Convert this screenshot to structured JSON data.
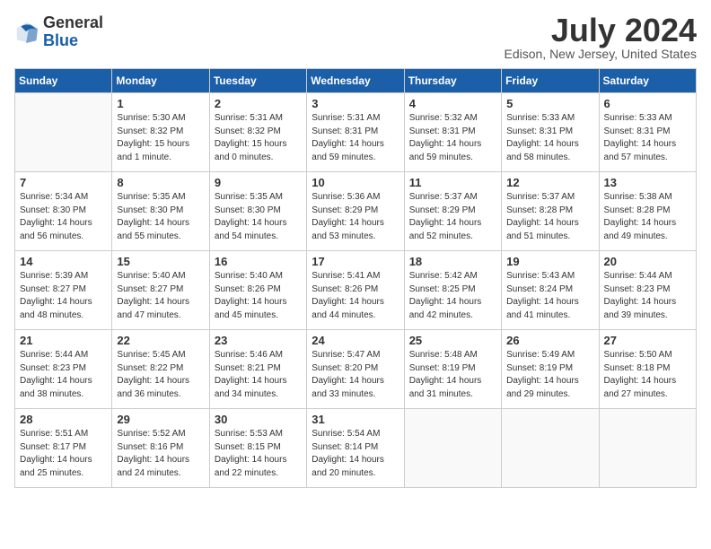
{
  "header": {
    "logo_general": "General",
    "logo_blue": "Blue",
    "month_title": "July 2024",
    "location": "Edison, New Jersey, United States"
  },
  "weekdays": [
    "Sunday",
    "Monday",
    "Tuesday",
    "Wednesday",
    "Thursday",
    "Friday",
    "Saturday"
  ],
  "weeks": [
    [
      {
        "day": "",
        "info": ""
      },
      {
        "day": "1",
        "info": "Sunrise: 5:30 AM\nSunset: 8:32 PM\nDaylight: 15 hours\nand 1 minute."
      },
      {
        "day": "2",
        "info": "Sunrise: 5:31 AM\nSunset: 8:32 PM\nDaylight: 15 hours\nand 0 minutes."
      },
      {
        "day": "3",
        "info": "Sunrise: 5:31 AM\nSunset: 8:31 PM\nDaylight: 14 hours\nand 59 minutes."
      },
      {
        "day": "4",
        "info": "Sunrise: 5:32 AM\nSunset: 8:31 PM\nDaylight: 14 hours\nand 59 minutes."
      },
      {
        "day": "5",
        "info": "Sunrise: 5:33 AM\nSunset: 8:31 PM\nDaylight: 14 hours\nand 58 minutes."
      },
      {
        "day": "6",
        "info": "Sunrise: 5:33 AM\nSunset: 8:31 PM\nDaylight: 14 hours\nand 57 minutes."
      }
    ],
    [
      {
        "day": "7",
        "info": "Sunrise: 5:34 AM\nSunset: 8:30 PM\nDaylight: 14 hours\nand 56 minutes."
      },
      {
        "day": "8",
        "info": "Sunrise: 5:35 AM\nSunset: 8:30 PM\nDaylight: 14 hours\nand 55 minutes."
      },
      {
        "day": "9",
        "info": "Sunrise: 5:35 AM\nSunset: 8:30 PM\nDaylight: 14 hours\nand 54 minutes."
      },
      {
        "day": "10",
        "info": "Sunrise: 5:36 AM\nSunset: 8:29 PM\nDaylight: 14 hours\nand 53 minutes."
      },
      {
        "day": "11",
        "info": "Sunrise: 5:37 AM\nSunset: 8:29 PM\nDaylight: 14 hours\nand 52 minutes."
      },
      {
        "day": "12",
        "info": "Sunrise: 5:37 AM\nSunset: 8:28 PM\nDaylight: 14 hours\nand 51 minutes."
      },
      {
        "day": "13",
        "info": "Sunrise: 5:38 AM\nSunset: 8:28 PM\nDaylight: 14 hours\nand 49 minutes."
      }
    ],
    [
      {
        "day": "14",
        "info": "Sunrise: 5:39 AM\nSunset: 8:27 PM\nDaylight: 14 hours\nand 48 minutes."
      },
      {
        "day": "15",
        "info": "Sunrise: 5:40 AM\nSunset: 8:27 PM\nDaylight: 14 hours\nand 47 minutes."
      },
      {
        "day": "16",
        "info": "Sunrise: 5:40 AM\nSunset: 8:26 PM\nDaylight: 14 hours\nand 45 minutes."
      },
      {
        "day": "17",
        "info": "Sunrise: 5:41 AM\nSunset: 8:26 PM\nDaylight: 14 hours\nand 44 minutes."
      },
      {
        "day": "18",
        "info": "Sunrise: 5:42 AM\nSunset: 8:25 PM\nDaylight: 14 hours\nand 42 minutes."
      },
      {
        "day": "19",
        "info": "Sunrise: 5:43 AM\nSunset: 8:24 PM\nDaylight: 14 hours\nand 41 minutes."
      },
      {
        "day": "20",
        "info": "Sunrise: 5:44 AM\nSunset: 8:23 PM\nDaylight: 14 hours\nand 39 minutes."
      }
    ],
    [
      {
        "day": "21",
        "info": "Sunrise: 5:44 AM\nSunset: 8:23 PM\nDaylight: 14 hours\nand 38 minutes."
      },
      {
        "day": "22",
        "info": "Sunrise: 5:45 AM\nSunset: 8:22 PM\nDaylight: 14 hours\nand 36 minutes."
      },
      {
        "day": "23",
        "info": "Sunrise: 5:46 AM\nSunset: 8:21 PM\nDaylight: 14 hours\nand 34 minutes."
      },
      {
        "day": "24",
        "info": "Sunrise: 5:47 AM\nSunset: 8:20 PM\nDaylight: 14 hours\nand 33 minutes."
      },
      {
        "day": "25",
        "info": "Sunrise: 5:48 AM\nSunset: 8:19 PM\nDaylight: 14 hours\nand 31 minutes."
      },
      {
        "day": "26",
        "info": "Sunrise: 5:49 AM\nSunset: 8:19 PM\nDaylight: 14 hours\nand 29 minutes."
      },
      {
        "day": "27",
        "info": "Sunrise: 5:50 AM\nSunset: 8:18 PM\nDaylight: 14 hours\nand 27 minutes."
      }
    ],
    [
      {
        "day": "28",
        "info": "Sunrise: 5:51 AM\nSunset: 8:17 PM\nDaylight: 14 hours\nand 25 minutes."
      },
      {
        "day": "29",
        "info": "Sunrise: 5:52 AM\nSunset: 8:16 PM\nDaylight: 14 hours\nand 24 minutes."
      },
      {
        "day": "30",
        "info": "Sunrise: 5:53 AM\nSunset: 8:15 PM\nDaylight: 14 hours\nand 22 minutes."
      },
      {
        "day": "31",
        "info": "Sunrise: 5:54 AM\nSunset: 8:14 PM\nDaylight: 14 hours\nand 20 minutes."
      },
      {
        "day": "",
        "info": ""
      },
      {
        "day": "",
        "info": ""
      },
      {
        "day": "",
        "info": ""
      }
    ]
  ]
}
